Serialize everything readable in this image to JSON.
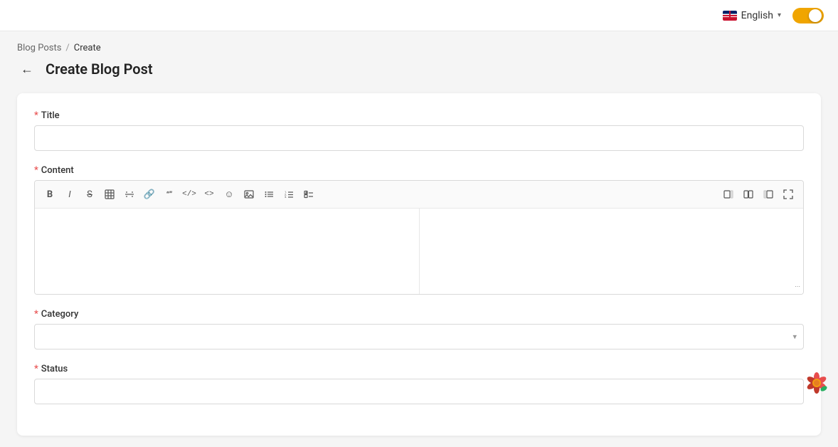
{
  "topbar": {
    "language": {
      "label": "English",
      "chevron": "▾"
    },
    "toggle": {
      "enabled": true
    }
  },
  "breadcrumb": {
    "parent": "Blog Posts",
    "separator": "/",
    "current": "Create"
  },
  "header": {
    "back_label": "←",
    "title": "Create Blog Post"
  },
  "form": {
    "title_label": "Title",
    "title_required": "*",
    "title_placeholder": "",
    "content_label": "Content",
    "content_required": "*",
    "category_label": "Category",
    "category_required": "*",
    "status_label": "Status",
    "status_required": "*"
  },
  "toolbar": {
    "bold": "B",
    "italic": "I",
    "strike": "S",
    "table": "⊞",
    "code_block": "</>",
    "blockquote": "\"\"",
    "code": "<>",
    "emoji": "☺",
    "image": "🖼",
    "bullet_list": "≡",
    "ordered_list": "☰",
    "task_list": "☑",
    "view_left": "⊡",
    "view_split": "⊞",
    "view_right": "⊟",
    "fullscreen": "⛶"
  },
  "resize_handle": "···"
}
